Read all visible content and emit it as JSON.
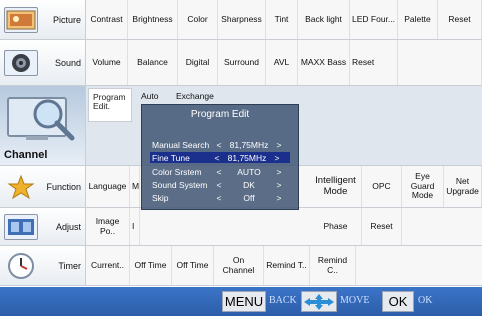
{
  "rows": [
    {
      "category": {
        "label": "Picture",
        "icon": "picture-icon"
      },
      "items": [
        "Contrast",
        "Brightness",
        "Color",
        "Sharpness",
        "Tint",
        "Back light",
        "LED Four...",
        "Palette",
        "Reset"
      ]
    },
    {
      "category": {
        "label": "Sound",
        "icon": "speaker-icon"
      },
      "items": [
        "Volume",
        "Balance",
        "Digital",
        "Surround",
        "AVL",
        "MAXX Bass",
        "Reset"
      ]
    },
    {
      "category": {
        "label": "Channel",
        "icon": "magnifier-tv-icon"
      },
      "items": [
        "Program Edit.",
        "Auto",
        "Exchange"
      ]
    },
    {
      "category": {
        "label": "Function",
        "icon": "star-icon"
      },
      "items": [
        "Language",
        "M",
        "Intelligent Mode",
        "OPC",
        "Eye Guard Mode",
        "Net Upgrade"
      ]
    },
    {
      "category": {
        "label": "Adjust",
        "icon": "adjust-icon"
      },
      "items": [
        "Image Po..",
        "I",
        "Phase",
        "Reset"
      ]
    },
    {
      "category": {
        "label": "Timer",
        "icon": "clock-icon"
      },
      "items": [
        "Current..",
        "Off Time",
        "Off Time",
        "On Channel",
        "Remind T..",
        "Remind C.."
      ]
    }
  ],
  "dialog": {
    "title": "Program Edit",
    "rows": [
      {
        "name": "Manual Search",
        "left": "<",
        "value": "81,75MHz",
        "right": ">",
        "selected": false
      },
      {
        "name": "Fine Tune",
        "left": "<",
        "value": "81,75MHz",
        "right": ">",
        "selected": true
      },
      {
        "name": "Color Srstem",
        "left": "<",
        "value": "AUTO",
        "right": ">",
        "selected": false
      },
      {
        "name": "Sound System",
        "left": "<",
        "value": "DK",
        "right": ">",
        "selected": false
      },
      {
        "name": "Skip",
        "left": "<",
        "value": "Off",
        "right": ">",
        "selected": false
      }
    ]
  },
  "footer": {
    "menu_label": "MENU",
    "back_label": "BACK",
    "move_icon": "move-arrows-icon",
    "move_label": "MOVE",
    "ok_label": "OK",
    "ok_text": "OK"
  }
}
